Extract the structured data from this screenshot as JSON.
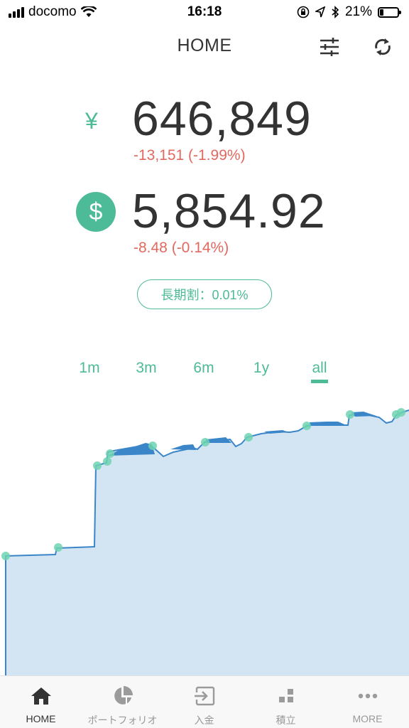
{
  "status_bar": {
    "carrier": "docomo",
    "time": "16:18",
    "battery": "21%",
    "battery_level": 0.21
  },
  "header": {
    "title": "HOME"
  },
  "yen": {
    "symbol": "¥",
    "value": "646,849",
    "change": "-13,151 (-1.99%)"
  },
  "usd": {
    "symbol": "$",
    "value": "5,854.92",
    "change": "-8.48 (-0.14%)"
  },
  "discount_badge": "長期割：0.01%",
  "range_tabs": [
    {
      "label": "1m"
    },
    {
      "label": "3m"
    },
    {
      "label": "6m"
    },
    {
      "label": "1y"
    },
    {
      "label": "all",
      "selected": true
    }
  ],
  "tab_bar": [
    {
      "label": "HOME",
      "icon": "home-icon",
      "active": true
    },
    {
      "label": "ポートフォリオ",
      "icon": "pie-chart-icon"
    },
    {
      "label": "入金",
      "icon": "deposit-icon"
    },
    {
      "label": "積立",
      "icon": "stacked-blocks-icon"
    },
    {
      "label": "MORE",
      "icon": "more-dots-icon"
    }
  ],
  "colors": {
    "accent": "#4dbb97",
    "negative": "#e1695f",
    "chart_line": "#3a86c8",
    "chart_fill": "#d3e5f3"
  }
}
